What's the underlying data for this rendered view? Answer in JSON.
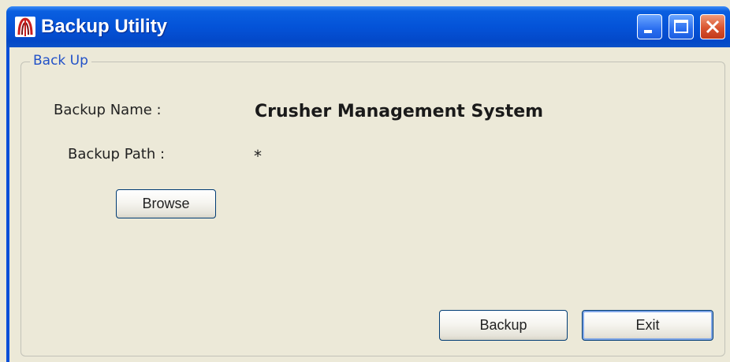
{
  "window": {
    "title": "Backup Utility",
    "title_bar_color": "#0453d8",
    "app_icon": "app-logo-icon",
    "controls": {
      "minimize": "minimize-icon",
      "maximize": "maximize-icon",
      "close": "close-icon"
    }
  },
  "group": {
    "label": "Back Up"
  },
  "form": {
    "backup_name_label": "Backup Name :",
    "backup_name_value": "Crusher Management System",
    "backup_path_label": "Backup Path :",
    "backup_path_value": "*"
  },
  "buttons": {
    "browse": "Browse",
    "backup": "Backup",
    "exit": "Exit"
  }
}
